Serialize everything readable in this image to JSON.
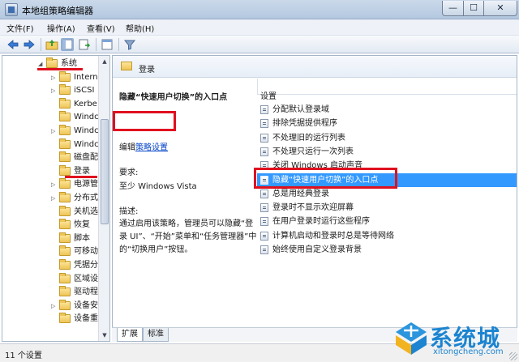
{
  "window": {
    "title": "本地组策略编辑器",
    "minimize": "—",
    "maximize": "☐",
    "close": "✕"
  },
  "menu": [
    "文件(F)",
    "操作(A)",
    "查看(V)",
    "帮助(H)"
  ],
  "toolbar_icons": [
    "back-icon",
    "forward-icon",
    "up-folder-icon",
    "show-tree-icon",
    "export-list-icon",
    "properties-icon",
    "filter-icon"
  ],
  "tree": {
    "items": [
      {
        "label": "系统",
        "expander": "◢",
        "selected": false
      },
      {
        "label": "Intern",
        "expander": "▷"
      },
      {
        "label": "iSCSI",
        "expander": "▷"
      },
      {
        "label": "Kerbe",
        "expander": ""
      },
      {
        "label": "Windc",
        "expander": ""
      },
      {
        "label": "Windc",
        "expander": "▷"
      },
      {
        "label": "Windc",
        "expander": ""
      },
      {
        "label": "磁盘配",
        "expander": ""
      },
      {
        "label": "登录",
        "expander": ""
      },
      {
        "label": "电源管",
        "expander": "▷"
      },
      {
        "label": "分布式",
        "expander": "▷"
      },
      {
        "label": "关机选",
        "expander": ""
      },
      {
        "label": "恢复",
        "expander": ""
      },
      {
        "label": "脚本",
        "expander": ""
      },
      {
        "label": "可移动",
        "expander": ""
      },
      {
        "label": "凭据分",
        "expander": ""
      },
      {
        "label": "区域设",
        "expander": ""
      },
      {
        "label": "驱动程",
        "expander": ""
      },
      {
        "label": "设备安",
        "expander": "▷"
      },
      {
        "label": "设备重",
        "expander": ""
      }
    ]
  },
  "content": {
    "header": "登录",
    "description": {
      "title": "隐藏“快速用户切换”的入口点",
      "edit_prefix": "编辑",
      "edit_link": "策略设置",
      "requirements_label": "要求:",
      "requirements_value": "至少 Windows Vista",
      "description_label": "描述:",
      "description_text": "通过启用该策略，管理员可以隐藏“登录 UI”、“开始”菜单和“任务管理器”中的“切换用户”按钮。"
    },
    "settings_header": "设置",
    "settings": [
      "分配默认登录域",
      "排除凭据提供程序",
      "不处理旧的运行列表",
      "不处理只运行一次列表",
      "关闭 Windows 启动声音",
      "隐藏“快速用户切换”的入口点",
      "总是用经典登录",
      "登录时不显示欢迎屏幕",
      "在用户登录时运行这些程序",
      "计算机启动和登录时总是等待网络",
      "始终使用自定义登录背景"
    ],
    "selected_setting_index": 5
  },
  "tabs": [
    "扩展",
    "标准"
  ],
  "status": "11 个设置",
  "watermark": {
    "name": "系统城",
    "url": "xitongcheng.com"
  },
  "colors": {
    "selection": "#3399ff",
    "annotation": "#e0101e",
    "link": "#0645c8",
    "watermark": "#1c84d0"
  }
}
